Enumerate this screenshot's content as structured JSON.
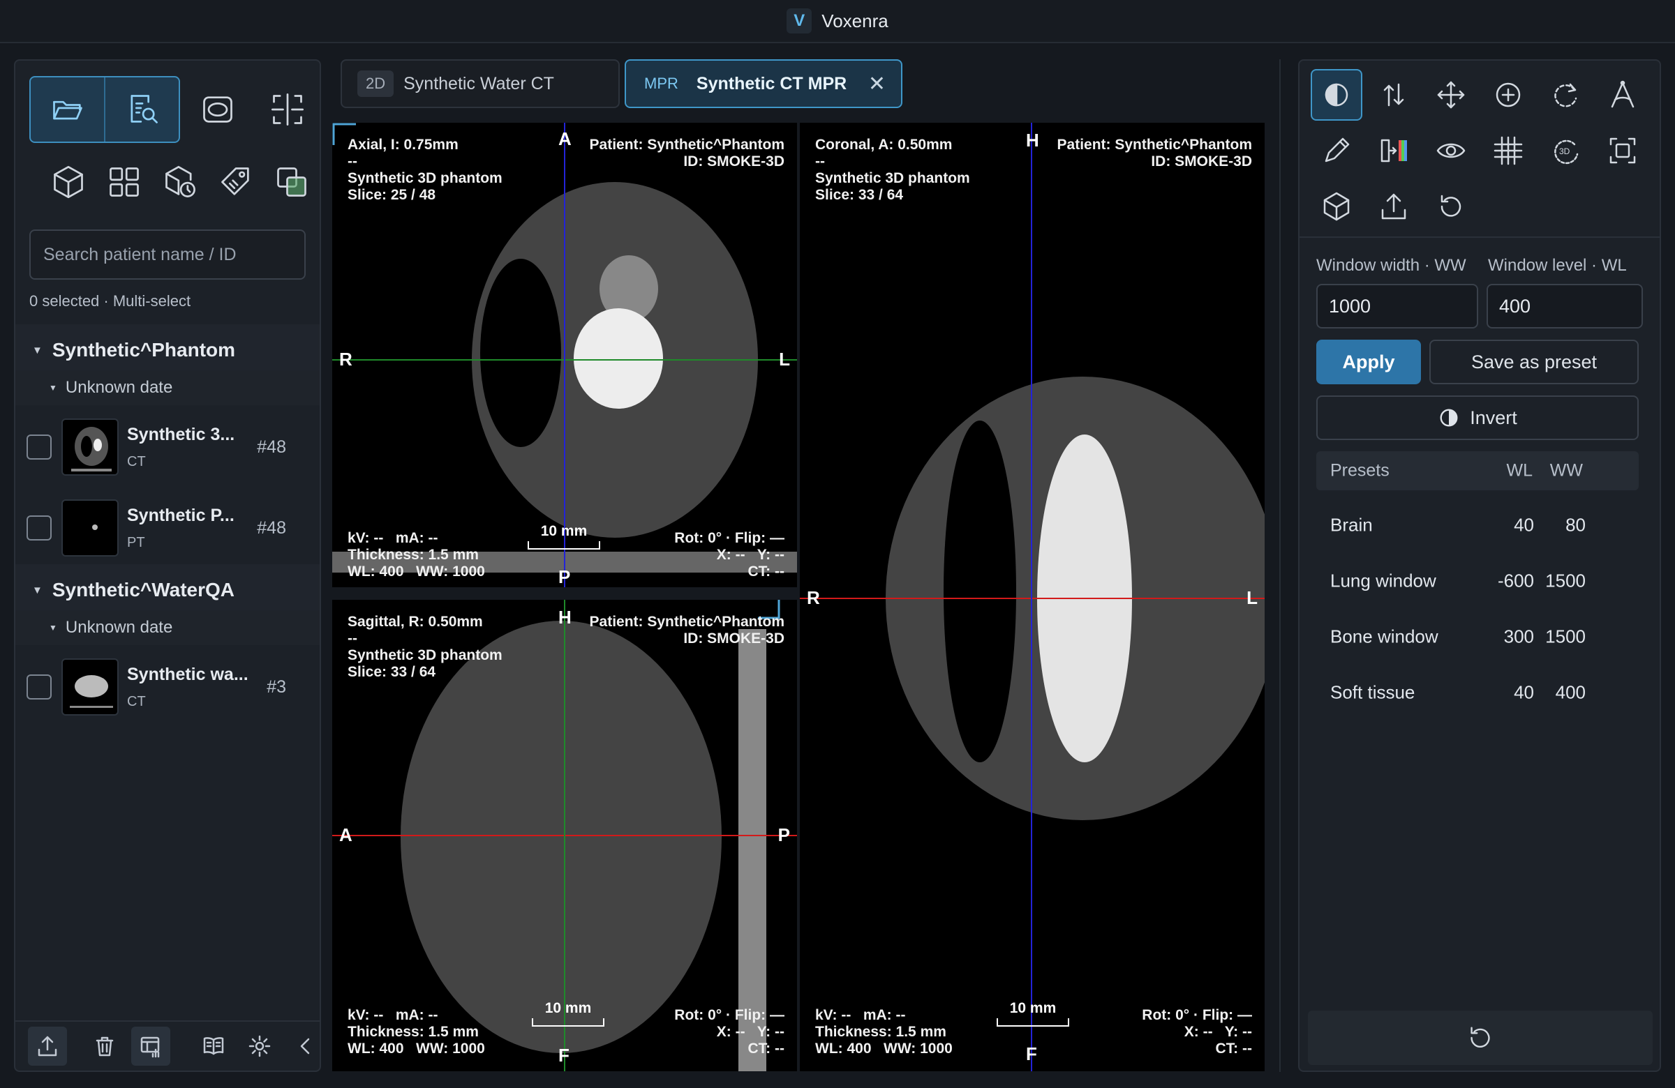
{
  "app": {
    "title": "Voxenra",
    "logo_letter": "V"
  },
  "sidebar": {
    "search_placeholder": "Search patient name / ID",
    "selection_status": "0 selected · Multi-select",
    "patients": [
      {
        "name": "Synthetic^Phantom",
        "date": "Unknown date",
        "series": [
          {
            "name": "Synthetic 3...",
            "modality": "CT",
            "count": "#48"
          },
          {
            "name": "Synthetic P...",
            "modality": "PT",
            "count": "#48"
          }
        ]
      },
      {
        "name": "Synthetic^WaterQA",
        "date": "Unknown date",
        "series": [
          {
            "name": "Synthetic wa...",
            "modality": "CT",
            "count": "#3"
          }
        ]
      }
    ]
  },
  "tabs": [
    {
      "badge": "2D",
      "label": "Synthetic Water CT"
    },
    {
      "badge": "MPR",
      "label": "Synthetic CT MPR",
      "close": "✕"
    }
  ],
  "viewports": {
    "axial": {
      "tl": "Axial, I: 0.75mm\n--\nSynthetic 3D phantom\nSlice: 25 / 48",
      "tr": "Patient: Synthetic^Phantom\nID: SMOKE-3D",
      "bl": "kV: --   mA: --\nThickness: 1.5 mm\nWL: 400   WW: 1000",
      "br": "Rot: 0° · Flip: —\nX: --   Y: --\nCT: --",
      "scale": "10 mm",
      "top": "A",
      "bottom": "P",
      "left": "R",
      "right": "L"
    },
    "sagittal": {
      "tl": "Sagittal, R: 0.50mm\n--\nSynthetic 3D phantom\nSlice: 33 / 64",
      "tr": "Patient: Synthetic^Phantom\nID: SMOKE-3D",
      "bl": "kV: --   mA: --\nThickness: 1.5 mm\nWL: 400   WW: 1000",
      "br": "Rot: 0° · Flip: —\nX: --   Y: --\nCT: --",
      "scale": "10 mm",
      "top": "H",
      "bottom": "F",
      "left": "A",
      "right": "P"
    },
    "coronal": {
      "tl": "Coronal, A: 0.50mm\n--\nSynthetic 3D phantom\nSlice: 33 / 64",
      "tr": "Patient: Synthetic^Phantom\nID: SMOKE-3D",
      "bl": "kV: --   mA: --\nThickness: 1.5 mm\nWL: 400   WW: 1000",
      "br": "Rot: 0° · Flip: —\nX: --   Y: --\nCT: --",
      "scale": "10 mm",
      "top": "H",
      "bottom": "F",
      "left": "R",
      "right": "L"
    }
  },
  "window_panel": {
    "ww_label": "Window width · WW",
    "wl_label": "Window level · WL",
    "ww_value": "1000",
    "wl_value": "400",
    "apply": "Apply",
    "save_preset": "Save as preset",
    "invert": "Invert",
    "presets_header": {
      "name": "Presets",
      "wl": "WL",
      "ww": "WW"
    },
    "presets": [
      {
        "name": "Brain",
        "wl": "40",
        "ww": "80"
      },
      {
        "name": "Lung window",
        "wl": "-600",
        "ww": "1500"
      },
      {
        "name": "Bone window",
        "wl": "300",
        "ww": "1500"
      },
      {
        "name": "Soft tissue",
        "wl": "40",
        "ww": "400"
      }
    ]
  },
  "colors": {
    "accent": "#3f97c9",
    "apply": "#2d75a8",
    "crosshair_axial_h": "#1f8a2a",
    "crosshair_blue": "#2323d8",
    "crosshair_red": "#d21a1a"
  }
}
